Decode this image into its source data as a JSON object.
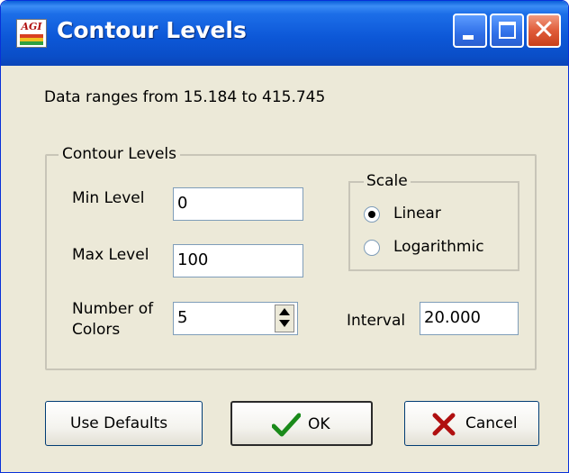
{
  "window": {
    "title": "Contour Levels",
    "app_icon_text": "AGI"
  },
  "info": {
    "data_range_text": "Data ranges from 15.184 to 415.745"
  },
  "contour_group": {
    "label": "Contour Levels",
    "min_level": {
      "label": "Min Level",
      "value": "0"
    },
    "max_level": {
      "label": "Max Level",
      "value": "100"
    },
    "num_colors": {
      "label_line1": "Number of",
      "label_line2": "Colors",
      "value": "5"
    },
    "interval": {
      "label": "Interval",
      "value": "20.000"
    },
    "scale": {
      "label": "Scale",
      "options": [
        "Linear",
        "Logarithmic"
      ],
      "selected": "Linear"
    }
  },
  "buttons": {
    "defaults": "Use Defaults",
    "ok": "OK",
    "cancel": "Cancel"
  },
  "colors": {
    "titlebar": "#0d58d8",
    "window_bg": "#ece9d8",
    "close_button": "#e05c3a"
  },
  "icons": [
    "app-icon",
    "minimize-icon",
    "maximize-icon",
    "close-icon",
    "checkmark-icon",
    "cancel-x-icon",
    "spin-up-icon",
    "spin-down-icon"
  ]
}
